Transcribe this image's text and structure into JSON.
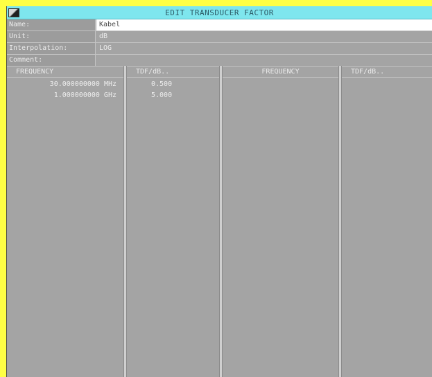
{
  "window": {
    "title": "EDIT TRANSDUCER FACTOR"
  },
  "fields": {
    "name": {
      "label": "Name:",
      "value": "Kabel"
    },
    "unit": {
      "label": "Unit:",
      "value": "dB"
    },
    "interpolation": {
      "label": "Interpolation:",
      "value": "LOG"
    },
    "comment": {
      "label": "Comment:",
      "value": ""
    }
  },
  "table": {
    "headers": [
      "FREQUENCY",
      "TDF/dB..",
      "FREQUENCY",
      "TDF/dB.."
    ],
    "rows": [
      {
        "frequency": "30.000000000 MHz",
        "tdf": "0.500"
      },
      {
        "frequency": "1.000000000 GHz",
        "tdf": "5.000"
      }
    ]
  },
  "colors": {
    "background": "#ffff44",
    "titlebar": "#7ee6ee",
    "panel": "#a4a4a4",
    "active_field": "#ffffff"
  }
}
